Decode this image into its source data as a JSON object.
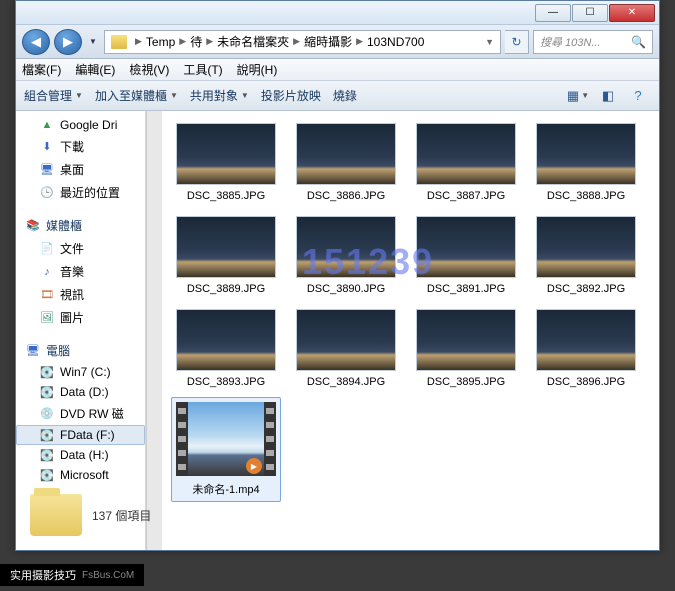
{
  "titlebar": {
    "min": "—",
    "max": "☐",
    "close": "✕"
  },
  "nav": {
    "back": "◀",
    "forward": "▶",
    "dropdown": "▼"
  },
  "breadcrumbs": [
    "Temp",
    "待",
    "未命名檔案夾",
    "縮時攝影",
    "103ND700"
  ],
  "address_refresh": "↻",
  "search": {
    "placeholder": "搜尋 103N...",
    "icon": "🔍"
  },
  "menubar": [
    "檔案(F)",
    "編輯(E)",
    "檢視(V)",
    "工具(T)",
    "說明(H)"
  ],
  "toolbar": {
    "organize": "組合管理",
    "include": "加入至媒體櫃",
    "share": "共用對象",
    "slideshow": "投影片放映",
    "burn": "燒錄"
  },
  "sidebar": {
    "favorites_items": [
      {
        "icon": "⬆",
        "label": "Google Dri",
        "color": "#3a9a4a"
      },
      {
        "icon": "⬇",
        "label": "下載",
        "color": "#3a6ac8"
      },
      {
        "icon": "🖥",
        "label": "桌面",
        "color": "#3a6ac8"
      },
      {
        "icon": "🕒",
        "label": "最近的位置",
        "color": "#c89a3a"
      }
    ],
    "libraries_head": "媒體櫃",
    "libraries_items": [
      {
        "icon": "📄",
        "label": "文件"
      },
      {
        "icon": "♪",
        "label": "音樂"
      },
      {
        "icon": "🎞",
        "label": "視訊"
      },
      {
        "icon": "🖼",
        "label": "圖片"
      }
    ],
    "computer_head": "電腦",
    "computer_items": [
      {
        "icon": "💽",
        "label": "Win7 (C:)"
      },
      {
        "icon": "💽",
        "label": "Data (D:)"
      },
      {
        "icon": "💿",
        "label": "DVD RW 磁"
      },
      {
        "icon": "💽",
        "label": "FData (F:)",
        "selected": true
      },
      {
        "icon": "💽",
        "label": "Data (H:)"
      },
      {
        "icon": "💽",
        "label": "Microsoft"
      }
    ]
  },
  "files": [
    "DSC_3885.JPG",
    "DSC_3886.JPG",
    "DSC_3887.JPG",
    "DSC_3888.JPG",
    "DSC_3889.JPG",
    "DSC_3890.JPG",
    "DSC_3891.JPG",
    "DSC_3892.JPG",
    "DSC_3893.JPG",
    "DSC_3894.JPG",
    "DSC_3895.JPG",
    "DSC_3896.JPG"
  ],
  "video_file": "未命名-1.mp4",
  "watermark": "151239",
  "status": {
    "count": "137 個項目"
  },
  "footer": {
    "brand": "实用摄影技巧",
    "sub": "FsBus.CoM"
  }
}
